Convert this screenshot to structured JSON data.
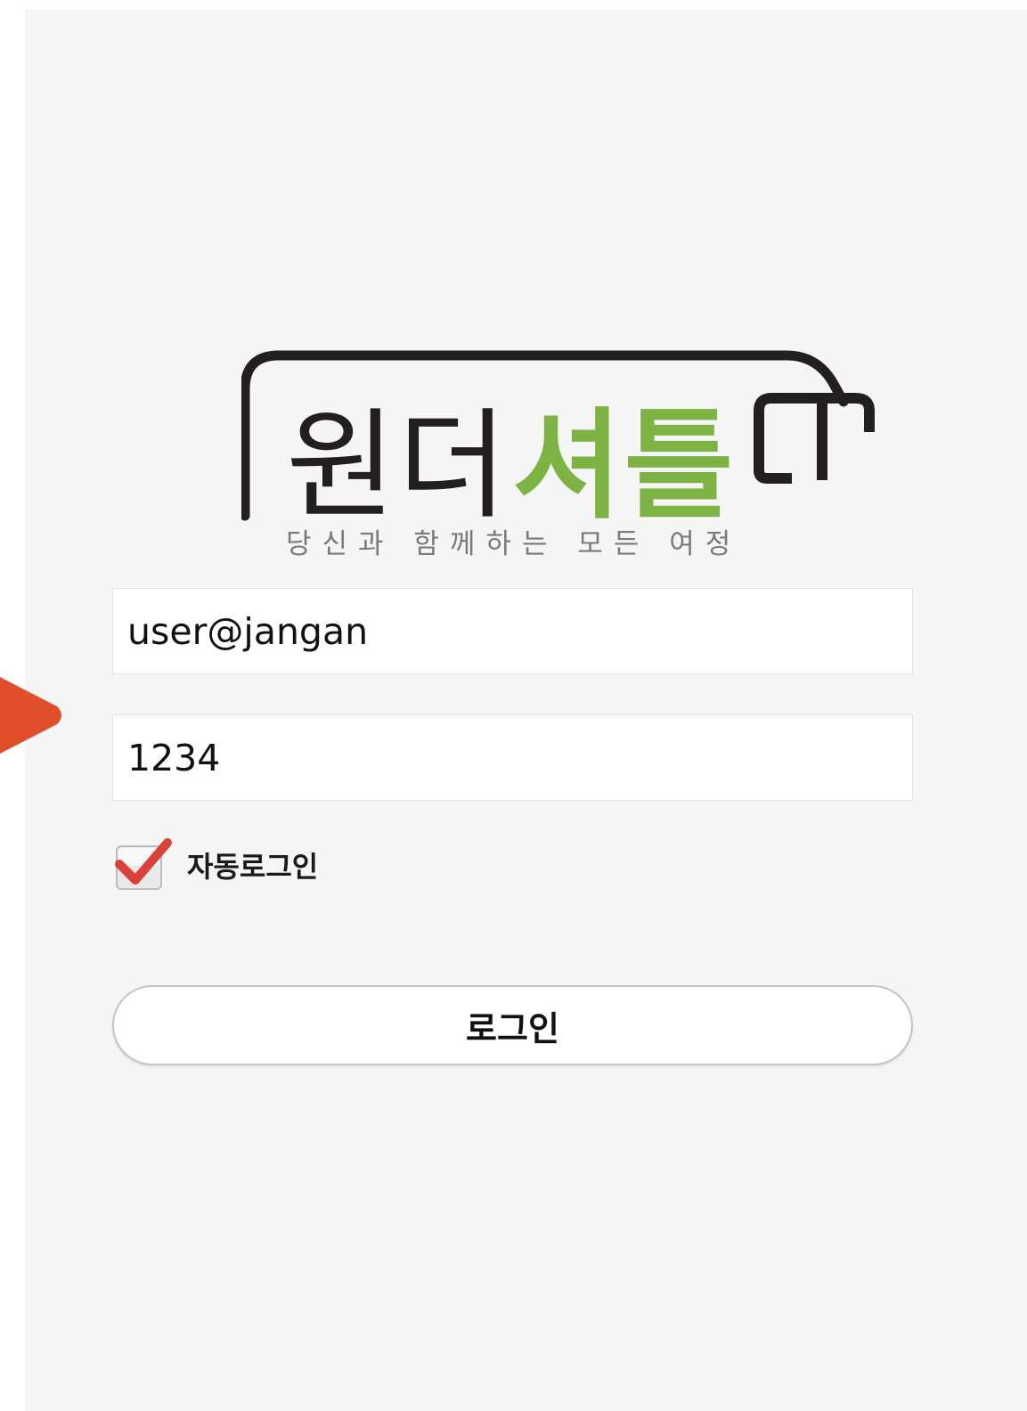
{
  "logo": {
    "wordmark_dark": "원더",
    "wordmark_green": "셔틀",
    "tagline": "당신과 함께하는 모든 여정",
    "green_color": "#7cb342",
    "dark_color": "#231f20"
  },
  "login_form": {
    "id_value": "user@jangan",
    "password_value": "1234",
    "auto_login_label": "자동로그인",
    "auto_login_checked": true,
    "login_button_label": "로그인"
  },
  "colors": {
    "background": "#f5f5f5",
    "pointer": "#e04e2a",
    "check": "#d9413a"
  }
}
